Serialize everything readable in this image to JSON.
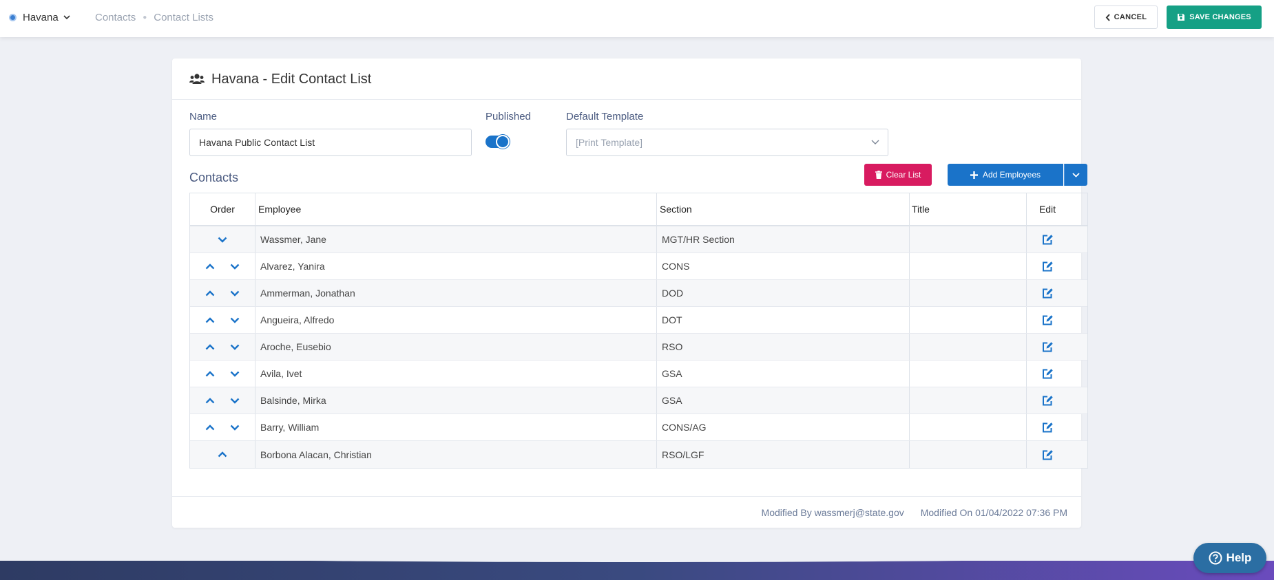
{
  "header": {
    "site_name": "Havana",
    "breadcrumbs": [
      "Contacts",
      "Contact Lists"
    ],
    "cancel_label": "CANCEL",
    "save_label": "SAVE CHANGES"
  },
  "card": {
    "title": "Havana - Edit Contact List",
    "name_label": "Name",
    "name_value": "Havana Public Contact List",
    "published_label": "Published",
    "published_on": true,
    "template_label": "Default Template",
    "template_placeholder": "[Print Template]",
    "contacts_title": "Contacts",
    "clear_label": "Clear List",
    "add_label": "Add Employees"
  },
  "table": {
    "columns": [
      "Order",
      "Employee",
      "Section",
      "Title",
      "Edit"
    ],
    "rows": [
      {
        "employee": "Wassmer, Jane",
        "section": "MGT/HR Section",
        "title": "",
        "up": false,
        "down": true
      },
      {
        "employee": "Alvarez, Yanira",
        "section": "CONS",
        "title": "",
        "up": true,
        "down": true
      },
      {
        "employee": "Ammerman, Jonathan",
        "section": "DOD",
        "title": "",
        "up": true,
        "down": true
      },
      {
        "employee": "Angueira, Alfredo",
        "section": "DOT",
        "title": "",
        "up": true,
        "down": true
      },
      {
        "employee": "Aroche, Eusebio",
        "section": "RSO",
        "title": "",
        "up": true,
        "down": true
      },
      {
        "employee": "Avila, Ivet",
        "section": "GSA",
        "title": "",
        "up": true,
        "down": true
      },
      {
        "employee": "Balsinde, Mirka",
        "section": "GSA",
        "title": "",
        "up": true,
        "down": true
      },
      {
        "employee": "Barry, William",
        "section": "CONS/AG",
        "title": "",
        "up": true,
        "down": true
      },
      {
        "employee": "Borbona Alacan, Christian",
        "section": "RSO/LGF",
        "title": "",
        "up": true,
        "down": false
      }
    ]
  },
  "footer": {
    "modified_by": "Modified By wassmerj@state.gov",
    "modified_on": "Modified On 01/04/2022 07:36 PM"
  },
  "help_label": "Help",
  "colors": {
    "primary": "#1a73c9",
    "save": "#15a085",
    "danger": "#d81b60"
  }
}
